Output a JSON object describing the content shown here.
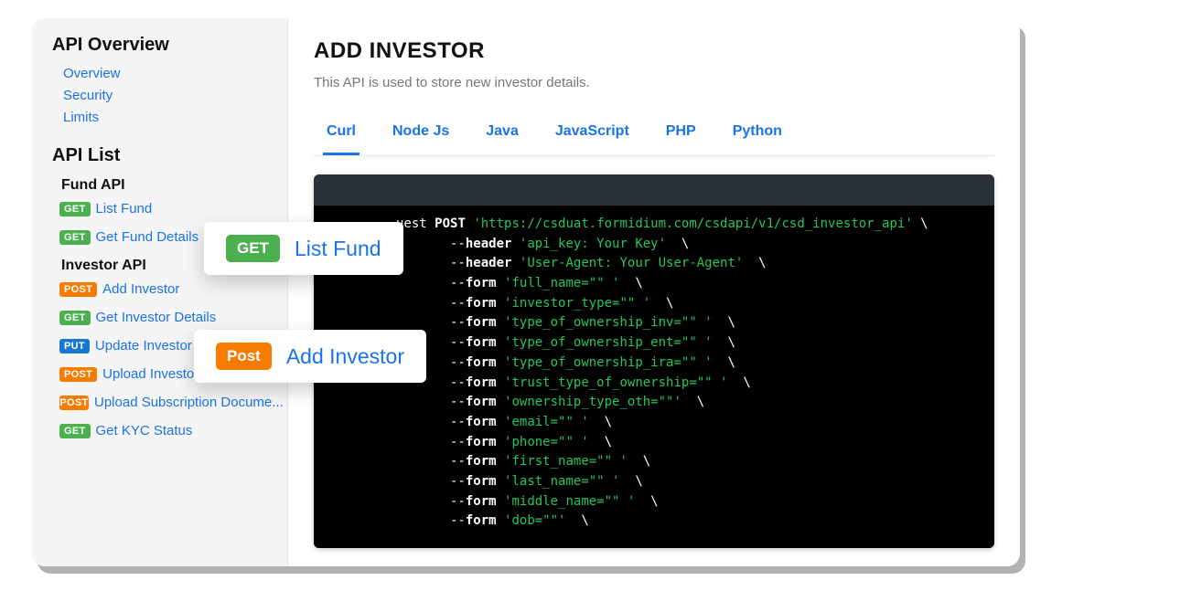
{
  "sidebar": {
    "overview_title": "API Overview",
    "overview_links": [
      "Overview",
      "Security",
      "Limits"
    ],
    "list_title": "API List",
    "groups": [
      {
        "title": "Fund API",
        "items": [
          {
            "method": "GET",
            "label": "List Fund"
          },
          {
            "method": "GET",
            "label": "Get Fund Details"
          }
        ]
      },
      {
        "title": "Investor API",
        "items": [
          {
            "method": "POST",
            "label": "Add Investor"
          },
          {
            "method": "GET",
            "label": "Get Investor Details"
          },
          {
            "method": "PUT",
            "label": "Update Investor"
          },
          {
            "method": "POST",
            "label": "Upload Investor Document"
          },
          {
            "method": "POST",
            "label": "Upload Subscription Docume..."
          },
          {
            "method": "GET",
            "label": "Get KYC Status"
          }
        ]
      }
    ]
  },
  "main": {
    "title": "ADD INVESTOR",
    "description": "This API is used to store new investor details.",
    "tabs": [
      "Curl",
      "Node Js",
      "Java",
      "JavaScript",
      "PHP",
      "Python"
    ],
    "active_tab": 0,
    "code": {
      "request_line": {
        "prefix": "uest ",
        "method": "POST",
        "url": "'https://csduat.formidium.com/csdapi/v1/csd_investor_api'"
      },
      "headers": [
        "'api_key: Your Key'",
        "'User-Agent: Your User-Agent'"
      ],
      "forms": [
        "'full_name=\"\" '",
        "'investor_type=\"\" '",
        "'type_of_ownership_inv=\"\" '",
        "'type_of_ownership_ent=\"\" '",
        "'type_of_ownership_ira=\"\" '",
        "'trust_type_of_ownership=\"\" '",
        "'ownership_type_oth=\"\"'",
        "'email=\"\" '",
        "'phone=\"\" '",
        "'first_name=\"\" '",
        "'last_name=\"\" '",
        "'middle_name=\"\" '",
        "'dob=\"\"'"
      ]
    }
  },
  "callouts": {
    "get": {
      "badge": "GET",
      "label": "List Fund"
    },
    "post": {
      "badge": "Post",
      "label": "Add Investor"
    }
  },
  "colors": {
    "link": "#1a73e8",
    "get": "#4caf50",
    "post": "#f57c00",
    "put": "#1976d2"
  }
}
